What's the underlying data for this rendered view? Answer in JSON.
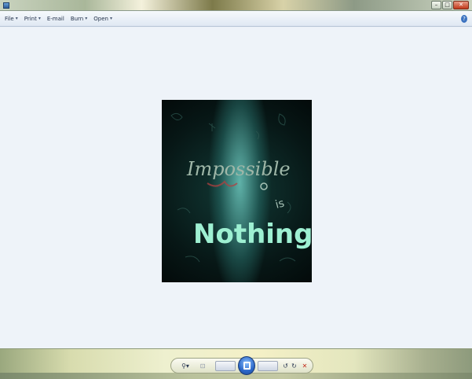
{
  "window": {
    "title": "",
    "caption_buttons": [
      "–",
      "□",
      "✕"
    ]
  },
  "menubar": {
    "items": [
      {
        "label": "File"
      },
      {
        "label": "Print"
      },
      {
        "label": "E-mail"
      },
      {
        "label": "Burn"
      },
      {
        "label": "Open"
      }
    ],
    "help_symbol": "?"
  },
  "photo": {
    "text_line1": "Impossible",
    "text_line2": "is",
    "text_line3": "Nothing",
    "colors": {
      "line1": "#9fb7a8",
      "line3": "#9ef0d2",
      "accent": "#b04040"
    }
  },
  "controls": {
    "zoom_symbol": "⚲▾",
    "fit_symbol": "⊡",
    "previous_label": "",
    "next_label": "",
    "rotate_ccw_symbol": "↺",
    "rotate_cw_symbol": "↻",
    "delete_symbol": "✕"
  },
  "status": {
    "left_text": ""
  }
}
